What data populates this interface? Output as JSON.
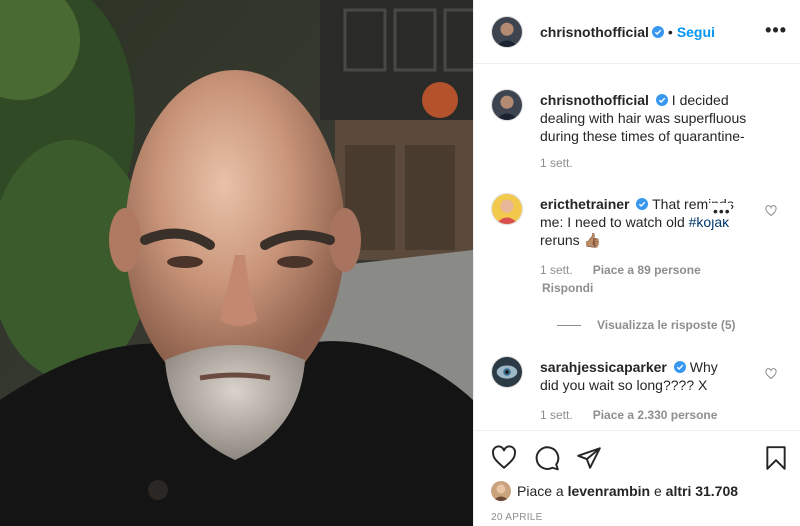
{
  "post": {
    "photo_alt": "",
    "header": {
      "username": "chrisnothofficial",
      "separator": "•",
      "follow_label": "Segui",
      "more_label": "•••"
    },
    "caption": {
      "username": "chrisnothofficial",
      "text": "I decided dealing with hair was superfluous during these times of quarantine-",
      "time": "1 sett."
    },
    "comments": [
      {
        "username": "ericthetrainer",
        "text_before": "That reminds me: I need to watch old ",
        "hashtag": "#kojak",
        "text_after": " reruns 👍🏽",
        "time": "1 sett.",
        "likes": "Piace a 89 persone",
        "reply_label": "Rispondi",
        "more_label": "•••",
        "view_replies": "Visualizza le risposte (5)"
      },
      {
        "username": "sarahjessicaparker",
        "text": "Why did you wait so long???? X",
        "time": "1 sett.",
        "likes": "Piace a 2.330 persone"
      }
    ],
    "likes_summary": {
      "prefix": "Piace a",
      "user": "levenrambin",
      "middle": "e",
      "others": "altri 31.708"
    },
    "date": "20 APRILE",
    "icons": {
      "like": "heart-icon",
      "comment": "comment-icon",
      "share": "send-icon",
      "save": "bookmark-icon",
      "verified": "verified-badge-icon"
    },
    "colors": {
      "accent": "#0095f6",
      "text": "#262626",
      "muted": "#8e8e8e",
      "hashtag": "#00376b"
    }
  }
}
